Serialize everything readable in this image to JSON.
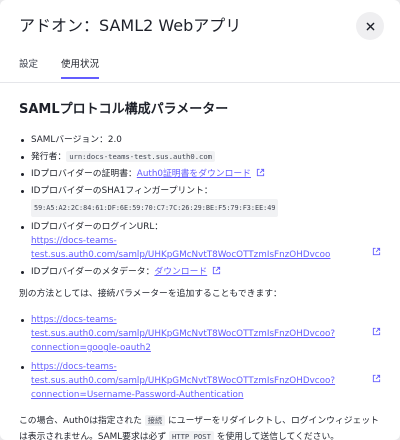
{
  "modal": {
    "title": "アドオン：SAML2 Webアプリ"
  },
  "tabs": [
    {
      "label": "設定",
      "active": false
    },
    {
      "label": "使用状況",
      "active": true
    }
  ],
  "section": {
    "title": "SAMLプロトコル構成パラメーター"
  },
  "params": {
    "version_label": "SAMLバージョン：",
    "version_value": "2.0",
    "issuer_label": "発行者：",
    "issuer_value": "urn:docs-teams-test.sus.auth0.com",
    "cert_label": "IDプロバイダーの証明書：",
    "cert_link": "Auth0証明書をダウンロード",
    "sha1_label": "IDプロバイダーのSHA1フィンガープリント：",
    "sha1_value": "59:A5:A2:2C:84:61:DF:6E:59:70:C7:7C:26:29:BE:F5:79:F3:EE:49",
    "login_label": "IDプロバイダーのログインURL：",
    "login_url_line1": "https://docs-teams-",
    "login_url_line2": "test.sus.auth0.com/samlp/UHKpGMcNvtT8WocOTTzmIsFnzOHDvcoo",
    "meta_label": "IDプロバイダーのメタデータ：",
    "meta_link": "ダウンロード"
  },
  "alt_text": "別の方法としては、接続パラメーターを追加することもできます：",
  "alts": [
    {
      "line1": "https://docs-teams-",
      "line2": "test.sus.auth0.com/samlp/UHKpGMcNvtT8WocOTTzmIsFnzOHDvcoo?",
      "line3": "connection=google-oauth2"
    },
    {
      "line1": "https://docs-teams-",
      "line2": "test.sus.auth0.com/samlp/UHKpGMcNvtT8WocOTTzmIsFnzOHDvcoo?",
      "line3": "connection=Username-Password-Authentication"
    }
  ],
  "footer": {
    "part1": "この場合、Auth0は指定された",
    "code1": "接続",
    "part2": "にユーザーをリダイレクトし、ログインウィジェットは表示されません。SAML要求は必ず",
    "code2": "HTTP POST",
    "part3": "を使用して送信してください。"
  },
  "colors": {
    "accent": "#635dff",
    "text": "#1e212a",
    "code_bg": "#f1f2f4"
  },
  "icons": {
    "close": "close-icon",
    "external": "external-link-icon"
  }
}
